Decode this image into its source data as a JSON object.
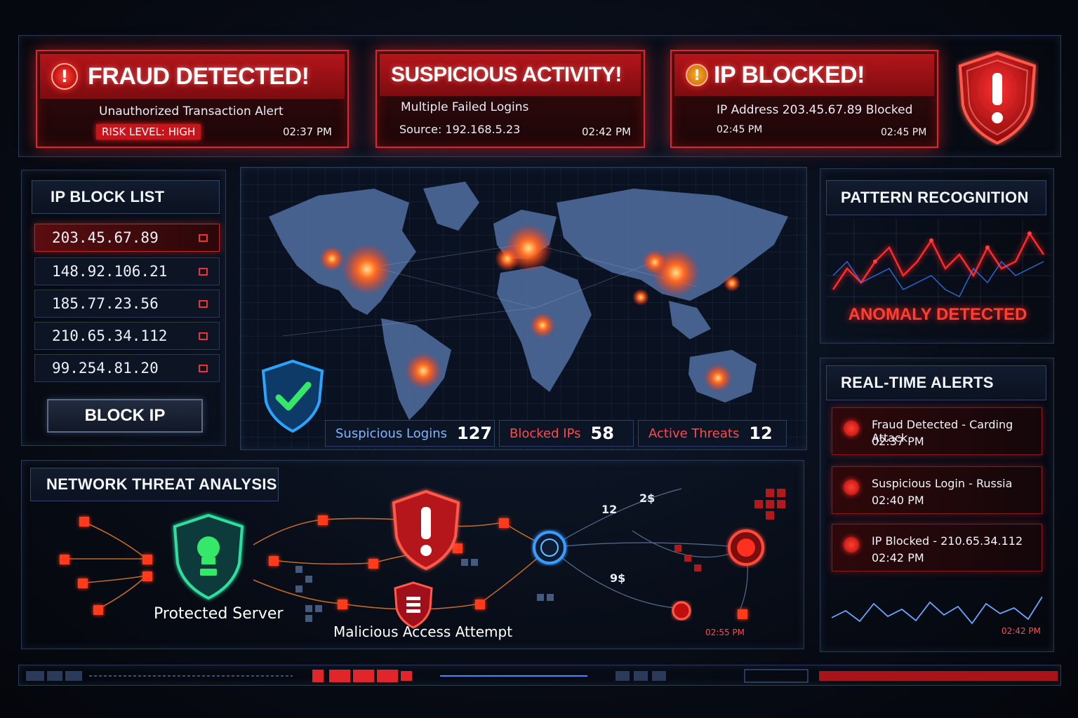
{
  "top_alerts": [
    {
      "title": "FRAUD DETECTED!",
      "subtitle": "Unauthorized Transaction Alert",
      "badge": "RISK LEVEL: HIGH",
      "time": "02:37 PM"
    },
    {
      "title": "SUSPICIOUS ACTIVITY!",
      "subtitle": "Multiple Failed Logins",
      "source": "Source: 192.168.5.23",
      "time": "02:42 PM"
    },
    {
      "title": "IP BLOCKED!",
      "subtitle": "IP Address 203.45.67.89 Blocked",
      "time_left": "02:45 PM",
      "time": "02:45 PM"
    }
  ],
  "ip_block_list": {
    "title": "IP BLOCK LIST",
    "items": [
      "203.45.67.89",
      "148.92.106.21",
      "185.77.23.56",
      "210.65.34.112",
      "99.254.81.20"
    ],
    "button_label": "BLOCK IP"
  },
  "map_stats": [
    {
      "label": "Suspicious Logins",
      "value": "127",
      "color": "#7fb6ff"
    },
    {
      "label": "Blocked IPs",
      "value": "58",
      "color": "#ff4a4a"
    },
    {
      "label": "Active Threats",
      "value": "12",
      "color": "#ff4a4a"
    }
  ],
  "pattern_recognition": {
    "title": "PATTERN RECOGNITION",
    "status": "ANOMALY DETECTED"
  },
  "realtime_alerts": {
    "title": "REAL-TIME ALERTS",
    "items": [
      {
        "title": "Fraud Detected - Carding Attack",
        "time": "02:37 PM"
      },
      {
        "title": "Suspicious Login - Russia",
        "time": "02:40 PM"
      },
      {
        "title": "IP Blocked - 210.65.34.112",
        "time": "02:42 PM"
      }
    ],
    "footer_time": "02:42 PM"
  },
  "network": {
    "title": "NETWORK THREAT ANALYSIS",
    "protected_label": "Protected Server",
    "malicious_label": "Malicious Access Attempt",
    "node_labels": [
      "12",
      "2$",
      "9$"
    ],
    "footer_time": "02:55 PM"
  },
  "colors": {
    "accent_red": "#e0262b",
    "accent_blue": "#3a8cff",
    "safe_green": "#2ee86a"
  },
  "icons": [
    "warning-icon",
    "shield-alert-icon",
    "shield-check-icon",
    "lock-icon",
    "close-square-icon"
  ]
}
